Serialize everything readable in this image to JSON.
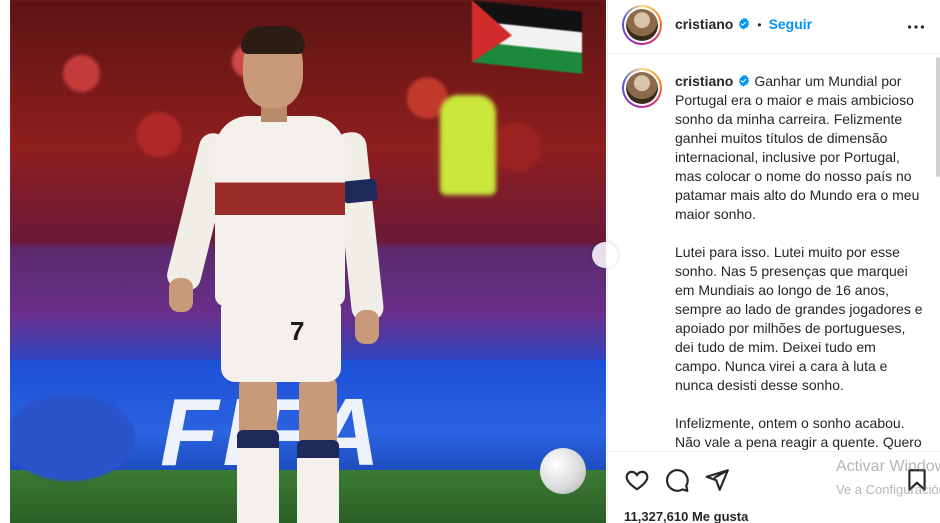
{
  "header": {
    "username": "cristiano",
    "separator": "•",
    "follow_label": "Seguir"
  },
  "caption": {
    "username": "cristiano",
    "paragraphs": [
      "Ganhar um Mundial por Portugal era o maior e mais ambicioso sonho da minha carreira. Felizmente ganhei muitos títulos de dimensão internacional, inclusive por Portugal, mas colocar o nome do nosso país no patamar mais alto do Mundo era o meu maior sonho.",
      "Lutei para isso. Lutei muito por esse sonho. Nas 5 presenças que marquei em Mundiais ao longo de 16 anos, sempre ao lado de grandes jogadores e apoiado por milhões de portugueses, dei tudo de mim. Deixei tudo em campo. Nunca virei a cara à luta e nunca desisti desse sonho.",
      "Infelizmente, ontem o sonho acabou. Não vale a pena reagir a quente. Quero apenas que todos saibam que"
    ]
  },
  "photo": {
    "board_text": "FIFA",
    "jersey_number": "7"
  },
  "actions": {
    "likes_text": "11,327,610 Me gusta"
  },
  "watermark": {
    "line1": "Activar Windows",
    "line2": "Ve a Configuración"
  },
  "colors": {
    "accent": "#0095f6",
    "verified": "#0095f6",
    "text": "#262626",
    "divider": "#efefef"
  },
  "icons": {
    "header_more": "more-horizontal-icon",
    "like": "heart-icon",
    "comment": "comment-icon",
    "share": "share-icon",
    "save": "bookmark-icon",
    "verified": "verified-badge-icon"
  }
}
